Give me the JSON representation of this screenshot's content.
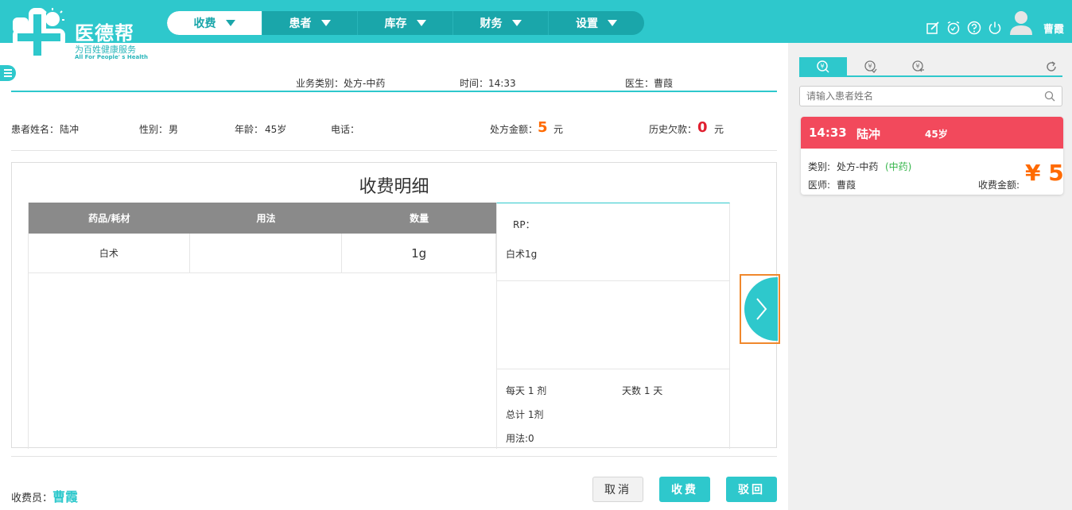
{
  "brand": {
    "title": "医德帮",
    "subtitle": "为百姓健康服务",
    "tagline": "All For People' s Health"
  },
  "nav": [
    {
      "label": "收费",
      "active": true
    },
    {
      "label": "患者",
      "active": false
    },
    {
      "label": "库存",
      "active": false
    },
    {
      "label": "财务",
      "active": false
    },
    {
      "label": "设置",
      "active": false
    }
  ],
  "header_icons": [
    "edit-icon",
    "alarm-icon",
    "help-icon",
    "power-icon"
  ],
  "user": {
    "name": "曹霞"
  },
  "info": {
    "business_type": "业务类别：处方-中药",
    "time": "时间：14:33",
    "doctor": "医生：曹葭"
  },
  "patient": {
    "name_label": "患者姓名：",
    "name": "陆冲",
    "gender_label": "性别：",
    "gender": "男",
    "age_label": "年龄：",
    "age": "45岁",
    "phone_label": "电话：",
    "phone": "",
    "rx_amount_label": "处方金额：",
    "rx_amount": "5",
    "rx_amount_unit": "元",
    "debt_label": "历史欠款：",
    "debt": "0",
    "debt_unit": "元"
  },
  "detail": {
    "title": "收费明细",
    "columns": [
      "药品/耗材",
      "用法",
      "数量"
    ],
    "rows": [
      {
        "item": "白术",
        "usage": "",
        "qty": "1g"
      }
    ]
  },
  "rp": {
    "label": "RP：",
    "content": "白术1g",
    "daily": "每天 1 剂",
    "days": "天数 1 天",
    "total": "总计 1剂",
    "usage": "用法:0"
  },
  "footer": {
    "cashier_label": "收费员：",
    "cashier_name": "曹霞",
    "cancel": "取消",
    "charge": "收费",
    "reject": "驳回"
  },
  "right": {
    "search_placeholder": "请输入患者姓名",
    "card": {
      "time": "14:33",
      "name": "陆冲",
      "age": "45岁",
      "type_label": "类别:",
      "type": "处方-中药",
      "tag": "(中药)",
      "doctor_label": "医师:",
      "doctor": "曹葭",
      "amount_label": "收费金额:",
      "amount": "¥ 5"
    }
  },
  "colors": {
    "teal": "#2ec8cc",
    "orange": "#ff6a00",
    "red": "#e01f2f",
    "card_red": "#f2495c",
    "green": "#35b54a"
  }
}
